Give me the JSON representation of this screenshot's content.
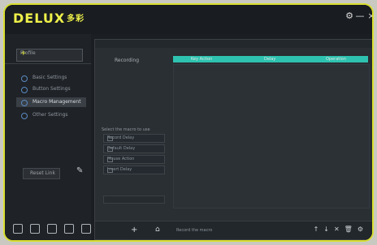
{
  "app": {
    "logo": "DELUX",
    "logo_cn": "多彩"
  },
  "window": {
    "gear": "⚙",
    "minus": "—",
    "close": "×"
  },
  "sidebar": {
    "profile": "Profile",
    "profile_add": "+",
    "items": [
      {
        "label": "Basic Settings"
      },
      {
        "label": "Button Settings"
      },
      {
        "label": "Macro Management"
      },
      {
        "label": "Other Settings"
      }
    ],
    "bottom_button": "Reset Link",
    "edit_icon": "✎"
  },
  "main": {
    "record_label": "Recording",
    "columns": [
      "Key Action",
      "Delay",
      "Operation"
    ],
    "panel_title": "Select the macro to use",
    "rows": [
      "Record Delay",
      "Default Delay",
      "Mouse Action",
      "Insert Delay"
    ],
    "footer": {
      "plus": "+",
      "home": "⌂",
      "status": "Record the macro",
      "icons": [
        "↑",
        "↓",
        "✕",
        "🗑",
        "⚙"
      ]
    }
  }
}
